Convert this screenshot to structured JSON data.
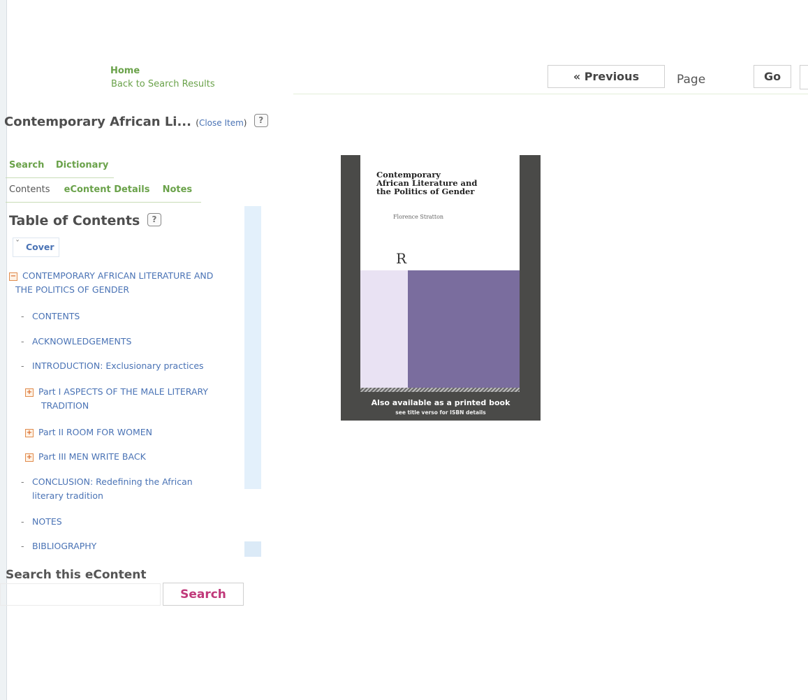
{
  "nav": {
    "home": "Home",
    "back": "Back to Search Results"
  },
  "item": {
    "title": "Contemporary African Li...",
    "close_prefix": "(",
    "close_link": "Close Item",
    "close_suffix": ")"
  },
  "help_glyph": "?",
  "tabs_top": [
    "Search",
    "Dictionary"
  ],
  "tabs_second": {
    "current": "Contents",
    "details": "eContent Details",
    "notes": "Notes"
  },
  "toc": {
    "heading": "Table of Contents",
    "cover": "Cover",
    "items": [
      {
        "marker": "minus-box",
        "line1": "CONTEMPORARY AFRICAN LITERATURE AND",
        "line2": "THE POLITICS OF GENDER"
      },
      {
        "marker": "dash",
        "line1": "CONTENTS"
      },
      {
        "marker": "dash",
        "line1": "ACKNOWLEDGEMENTS"
      },
      {
        "marker": "dash",
        "line1": "INTRODUCTION: Exclusionary practices"
      },
      {
        "marker": "plus-box",
        "line1": "Part I ASPECTS OF THE MALE LITERARY",
        "line2": "TRADITION"
      },
      {
        "marker": "plus-box",
        "line1": "Part II ROOM FOR WOMEN"
      },
      {
        "marker": "plus-box",
        "line1": "Part III MEN WRITE BACK"
      },
      {
        "marker": "dash",
        "line1": "CONCLUSION: Redefining the African",
        "line2": "literary tradition"
      },
      {
        "marker": "dash",
        "line1": "NOTES"
      },
      {
        "marker": "dash",
        "line1": "BIBLIOGRAPHY"
      }
    ]
  },
  "search": {
    "label": "Search this eContent",
    "button": "Search"
  },
  "toolbar": {
    "previous": "« Previous",
    "page_label": "Page",
    "go": "Go"
  },
  "book": {
    "title_lines": [
      "Contemporary",
      "African Literature and",
      "the Politics of Gender"
    ],
    "author": "Florence Stratton",
    "logo": "R",
    "caption": "Also available as a printed book",
    "caption_sub": "see title verso for ISBN details"
  },
  "colors": {
    "nav_green": "#6aa24a",
    "link_blue": "#4a73b5",
    "search_pink": "#c0397a",
    "book_purple": "#7a6d9e"
  }
}
